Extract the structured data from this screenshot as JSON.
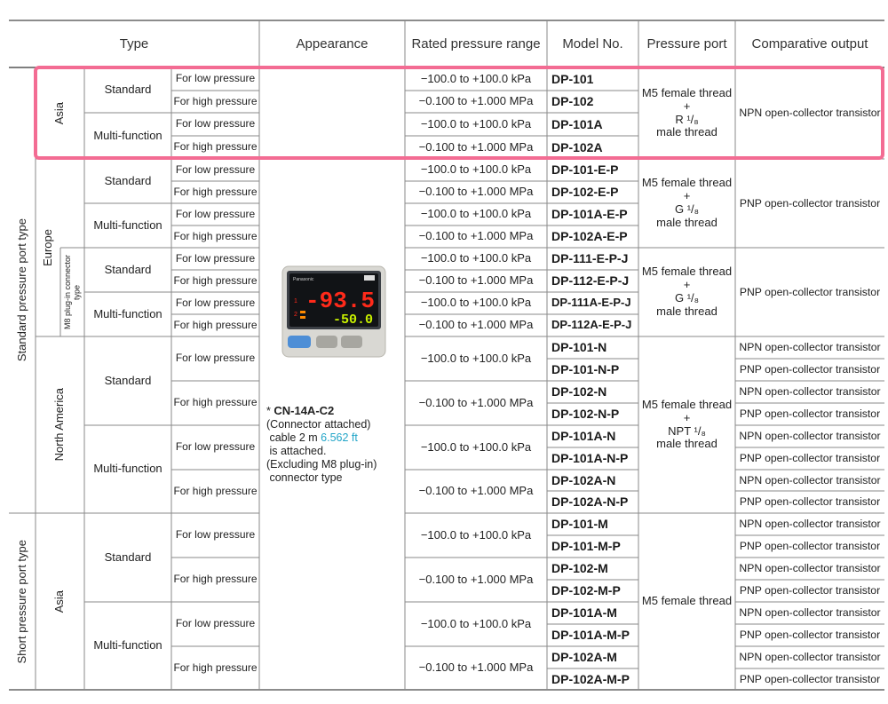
{
  "headers": {
    "type": "Type",
    "appearance": "Appearance",
    "rated_range": "Rated pressure range",
    "model_no": "Model No.",
    "pressure_port": "Pressure port",
    "output": "Comparative output"
  },
  "groups": {
    "standard_port": "Standard pressure port type",
    "short_port": "Short pressure port type",
    "asia": "Asia",
    "europe": "Europe",
    "m8": "M8 plug-in connector type",
    "north_america": "North America",
    "asia_short": "Asia"
  },
  "labels": {
    "standard": "Standard",
    "multi": "Multi-function",
    "low": "For low pressure",
    "high": "For high pressure"
  },
  "ranges": {
    "kpa": "−100.0 to +100.0 kPa",
    "mpa": "−0.100 to +1.000 MPa"
  },
  "ports": {
    "asia": {
      "l1": "M5 female thread",
      "l2": "+",
      "l3": "R ¹/₈",
      "l4": "male thread"
    },
    "europe": {
      "l1": "M5 female thread",
      "l2": "+",
      "l3": "G ¹/₈",
      "l4": "male thread"
    },
    "m8": {
      "l1": "M5 female thread",
      "l2": "+",
      "l3": "G ¹/₈",
      "l4": "male thread"
    },
    "na": {
      "l1": "M5 female thread",
      "l2": "+",
      "l3": "NPT ¹/₈",
      "l4": "male thread"
    },
    "short": {
      "l1": "M5 female thread"
    }
  },
  "outputs": {
    "npn": "NPN open-collector transistor",
    "pnp": "PNP open-collector transistor"
  },
  "models": {
    "asia": [
      "DP-101",
      "DP-102",
      "DP-101A",
      "DP-102A"
    ],
    "europe": [
      "DP-101-E-P",
      "DP-102-E-P",
      "DP-101A-E-P",
      "DP-102A-E-P"
    ],
    "m8": [
      "DP-111-E-P-J",
      "DP-112-E-P-J",
      "DP-111A-E-P-J",
      "DP-112A-E-P-J"
    ],
    "na": [
      "DP-101-N",
      "DP-101-N-P",
      "DP-102-N",
      "DP-102-N-P",
      "DP-101A-N",
      "DP-101A-N-P",
      "DP-102A-N",
      "DP-102A-N-P"
    ],
    "short": [
      "DP-101-M",
      "DP-101-M-P",
      "DP-102-M",
      "DP-102-M-P",
      "DP-101A-M",
      "DP-101A-M-P",
      "DP-102A-M",
      "DP-102A-M-P"
    ]
  },
  "note": {
    "star": "*",
    "model": "CN-14A-C2",
    "line1": "Connector attached",
    "line2a": "cable 2 m",
    "line2b": "6.562 ft",
    "line3": "is attached.",
    "line4": "Excluding M8 plug-in",
    "line5": "connector type"
  },
  "device": {
    "brand": "Panasonic",
    "main_value": "-93.5",
    "sub_value": "-50.0",
    "ind1": "1",
    "ind2": "2"
  },
  "colors": {
    "highlight": "#f36c93",
    "link": "#22a5c8",
    "lcd_red": "#ff2a1a",
    "lcd_green": "#c8f000"
  }
}
